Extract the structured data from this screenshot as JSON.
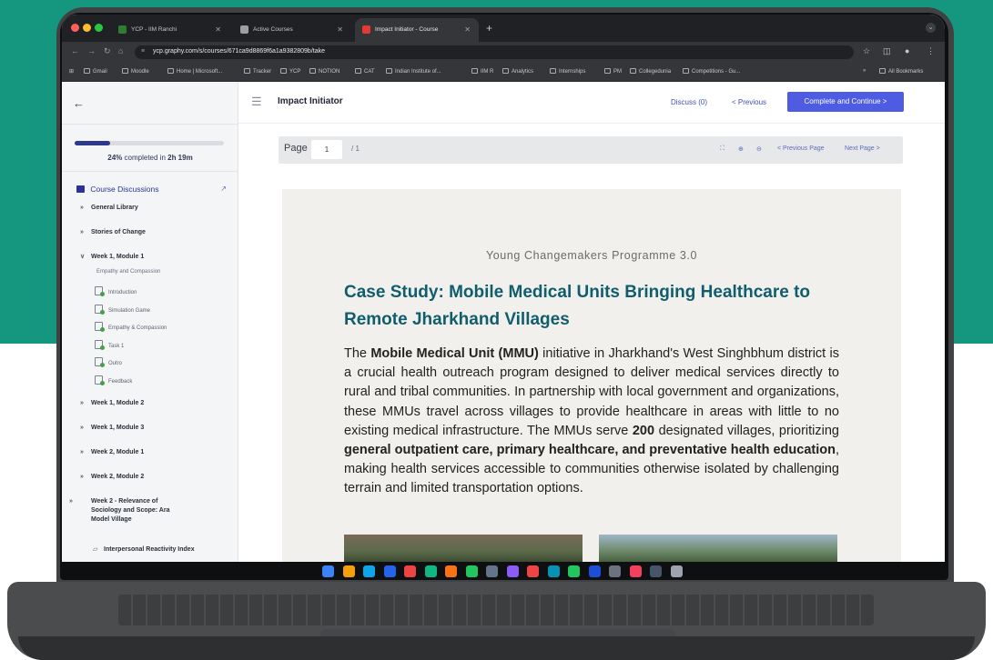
{
  "browser": {
    "tabs": [
      {
        "title": "YCP - IIM Ranchi",
        "active": false,
        "icon_color": "#2e7d32"
      },
      {
        "title": "Active Courses",
        "active": false,
        "icon_color": "#9e9e9e"
      },
      {
        "title": "Impact Initiator - Course",
        "active": true,
        "icon_color": "#e53935"
      }
    ],
    "new_tab_icon": "plus-icon",
    "url": "ycp.graphy.com/s/courses/671ca9d8869f6a1a9382809b/take",
    "bookmarks": [
      "Gmail",
      "Moodle",
      "Home | Microsoft...",
      "Tracker",
      "YCP",
      "NOTION",
      "CAT",
      "Indian Institute of...",
      "IIM R",
      "Analytics",
      "Internships",
      "PM",
      "Collegedunia",
      "Competitions - Gu..."
    ],
    "all_bookmarks": "All Bookmarks"
  },
  "sidebar": {
    "progress_fraction": 0.24,
    "progress_percent": "24%",
    "progress_completed_text": "completed in",
    "progress_time": "2h 19m",
    "discussions_label": "Course Discussions",
    "modules": [
      {
        "label": "General Library",
        "expanded": false
      },
      {
        "label": "Stories of Change",
        "expanded": false
      },
      {
        "label": "Week 1, Module 1",
        "expanded": true,
        "subhead": "Empathy and Compassion",
        "lessons": [
          "Introduction",
          "Simulation Game",
          "Empathy & Compassion",
          "Task 1",
          "Outro",
          "Feedback"
        ]
      },
      {
        "label": "Week 1, Module 2",
        "expanded": false
      },
      {
        "label": "Week 1, Module 3",
        "expanded": false
      },
      {
        "label": "Week 2, Module 1",
        "expanded": false
      },
      {
        "label": "Week 2, Module 2",
        "expanded": false
      },
      {
        "label": "Week 2 - Relevance of Sociology and Scope: Ara Model Village",
        "expanded": false
      }
    ],
    "current_item": "Interpersonal Reactivity Index"
  },
  "header": {
    "course_title": "Impact Initiator",
    "discuss": "Discuss (0)",
    "previous": "< Previous",
    "complete": "Complete and Continue >"
  },
  "pdf_toolbar": {
    "page_label": "Page",
    "current_page": "1",
    "total_pages": "/ 1",
    "previous_page": "< Previous Page",
    "next_page": "Next Page >"
  },
  "document": {
    "program": "Young Changemakers Programme 3.0",
    "title": "Case Study: Mobile Medical Units Bringing Healthcare to Remote Jharkhand Villages",
    "body": [
      {
        "t": "The ",
        "b": false
      },
      {
        "t": "Mobile Medical Unit (MMU)",
        "b": true
      },
      {
        "t": " initiative in Jharkhand's West Singhbhum district is a crucial health outreach program designed to deliver medical services directly to rural and tribal communities. In partnership with local government and organizations, these MMUs travel across villages to provide healthcare in areas with little to no existing medical infrastructure. The MMUs serve ",
        "b": false
      },
      {
        "t": "200",
        "b": true
      },
      {
        "t": " designated villages, prioritizing ",
        "b": false
      },
      {
        "t": "general outpatient care, primary healthcare, and preventative health education",
        "b": true
      },
      {
        "t": ", making health services accessible to communities otherwise isolated by challenging terrain and limited transportation options.",
        "b": false
      }
    ]
  },
  "colors": {
    "background_teal": "#14967f",
    "primary_button": "#4e5be3",
    "doc_title": "#0f5d6d",
    "progress": "#2d3a8c"
  },
  "dock_apps": [
    "#3b82f6",
    "#f59e0b",
    "#0ea5e9",
    "#2563eb",
    "#ef4444",
    "#10b981",
    "#f97316",
    "#22c55e",
    "#64748b",
    "#8b5cf6",
    "#ef4444",
    "#0891b2",
    "#22c55e",
    "#1d4ed8",
    "#6b7280",
    "#f43f5e",
    "#475569",
    "#9ca3af"
  ]
}
